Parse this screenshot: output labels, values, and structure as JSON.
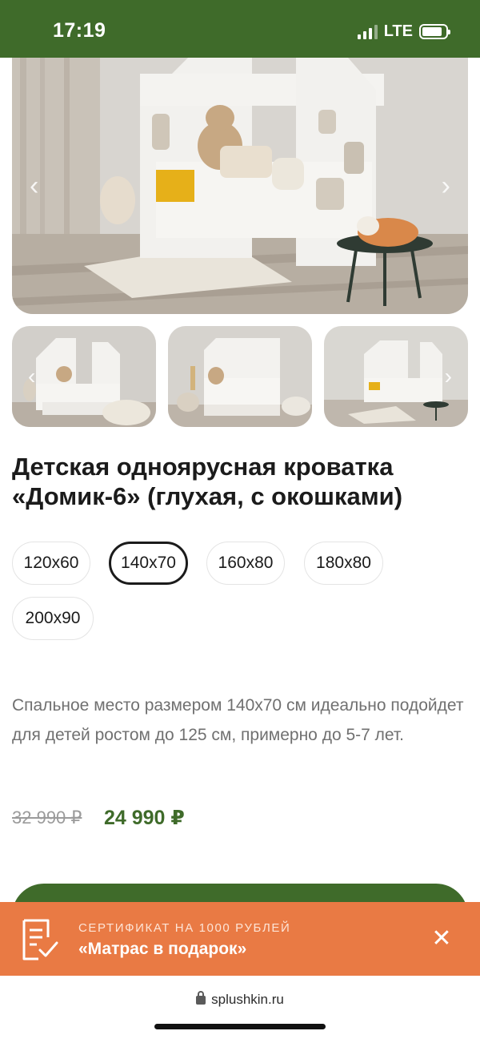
{
  "status_bar": {
    "time": "17:19",
    "network": "LTE",
    "battery_level": 0.85
  },
  "gallery": {
    "prev_icon": "chevron-left-icon",
    "next_icon": "chevron-right-icon",
    "prev_glyph": "‹",
    "next_glyph": "›"
  },
  "product": {
    "title": "Детская одноярусная кроватка «Домик-6» (глухая, с окошками)",
    "sizes": [
      "120x60",
      "140x70",
      "160x80",
      "180x80",
      "200x90"
    ],
    "selected_size": "140x70",
    "description": "Спальное место размером 140x70 см идеально подойдет для детей ростом до 125 см, примерно до 5-7 лет.",
    "old_price": "32 990 ₽",
    "new_price": "24 990 ₽"
  },
  "promo": {
    "icon": "certificate-check-icon",
    "caption": "СЕРТИФИКАТ НА 1000 РУБЛЕЙ",
    "text": "«Матрас в подарок»",
    "close_glyph": "✕"
  },
  "browser": {
    "url": "splushkin.ru"
  },
  "colors": {
    "brand_green": "#3f6b2a",
    "promo_orange": "#e97a44",
    "text_muted": "#707070"
  }
}
